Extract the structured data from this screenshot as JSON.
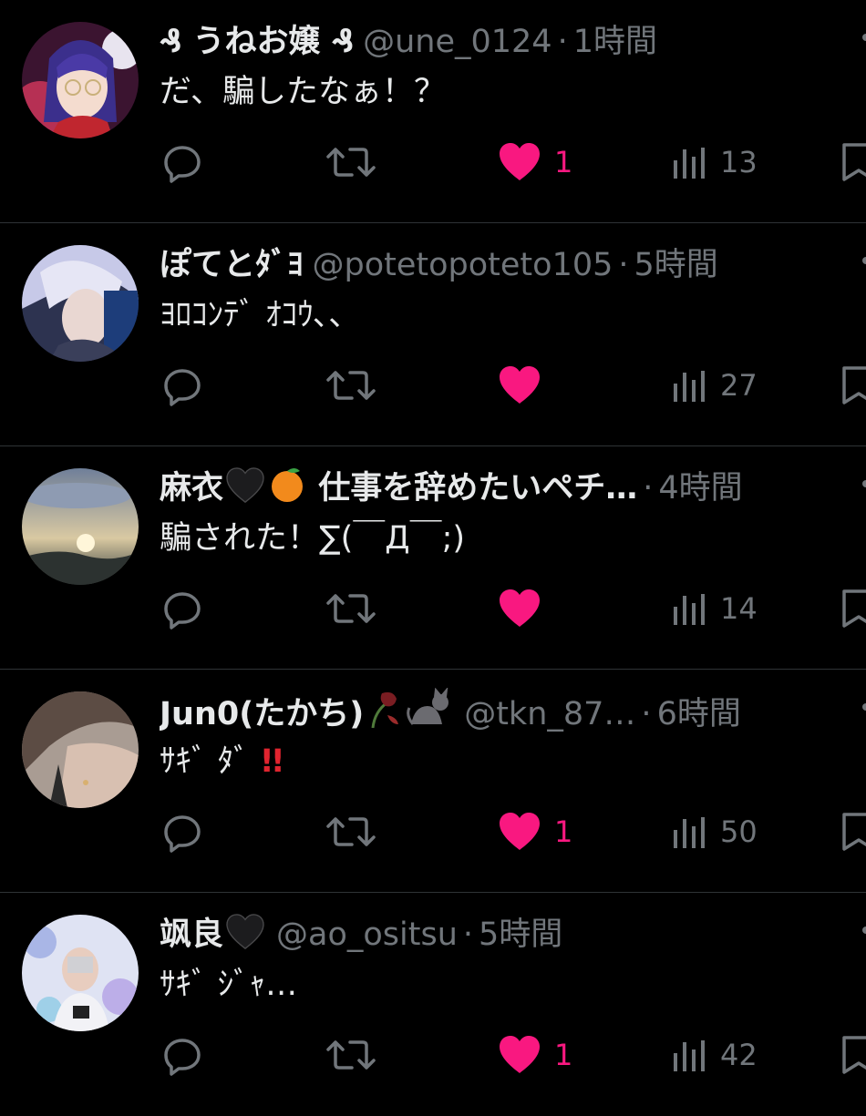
{
  "tweets": [
    {
      "display_name": "うねお嬢",
      "name_prefix": "₰",
      "name_suffix": "₰",
      "handle": "@une_0124",
      "separator": "·",
      "time": "1時間",
      "text": "だ、騙したなぁ！？",
      "reply_count": "",
      "retweet_count": "",
      "like_count": "1",
      "view_count": "13",
      "liked": true
    },
    {
      "display_name": "ぽてとﾀﾞﾖ",
      "handle": "@potetopoteto105",
      "separator": "·",
      "time": "5時間",
      "text": "ﾖﾛｺﾝﾃﾞ ｵｺｳ､､",
      "like_count": "",
      "view_count": "27",
      "liked": true
    },
    {
      "display_name_a": "麻衣",
      "display_name_b": "仕事を辞めたいペチ…",
      "handle": "",
      "separator": "·",
      "time": "4時間",
      "text": "騙された！∑(￣Д￣;)",
      "like_count": "",
      "view_count": "14",
      "liked": true
    },
    {
      "display_name": "Jun0(たかち)",
      "handle": "@tkn_87…",
      "separator": "·",
      "time": "6時間",
      "text": "ｻｷﾞ ﾀﾞ",
      "text_emphasis": "!!",
      "like_count": "1",
      "view_count": "50",
      "liked": true
    },
    {
      "display_name": "飒良",
      "handle": "@ao_ositsu",
      "separator": "·",
      "time": "5時間",
      "text": "ｻｷﾞ ｼﾞｬ…",
      "like_count": "1",
      "view_count": "42",
      "liked": true
    }
  ],
  "colors": {
    "background": "#000000",
    "text": "#e7e9ea",
    "muted": "#71767b",
    "like": "#f91880",
    "divider": "#2f3336"
  },
  "icons": [
    "reply-icon",
    "retweet-icon",
    "like-icon",
    "views-icon",
    "bookmark-icon",
    "more-icon",
    "black-heart-emoji",
    "orange-emoji",
    "wilted-rose-emoji",
    "black-cat-emoji",
    "double-exclamation-emoji"
  ]
}
